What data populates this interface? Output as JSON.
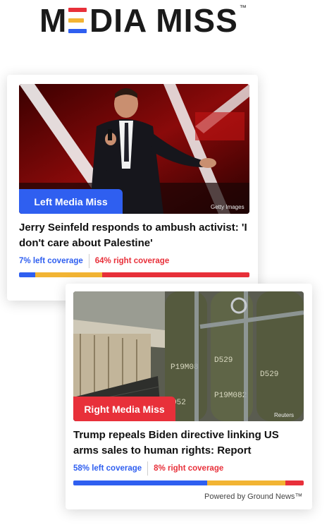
{
  "logo": {
    "m": "M",
    "e": "E",
    "rest": "DIA MISS",
    "tm": "™"
  },
  "cards": [
    {
      "badge": "Left Media Miss",
      "photo_credit": "Getty Images",
      "headline": "Jerry Seinfeld responds to ambush activist: 'I don't care about Palestine'",
      "left_coverage": "7% left coverage",
      "right_coverage": "64% right coverage",
      "bar": {
        "left_pct": 7,
        "center_pct": 29,
        "right_pct": 64
      }
    },
    {
      "badge": "Right Media Miss",
      "photo_credit": "Reuters",
      "headline": "Trump repeals Biden directive linking US arms sales to human rights: Report",
      "left_coverage": "58% left coverage",
      "right_coverage": "8% right coverage",
      "bar": {
        "left_pct": 58,
        "center_pct": 34,
        "right_pct": 8
      }
    }
  ],
  "footer": {
    "powered_by": "Powered by Ground News™"
  },
  "colors": {
    "left": "#2f5ff0",
    "center": "#f2b433",
    "right": "#e8303a"
  }
}
